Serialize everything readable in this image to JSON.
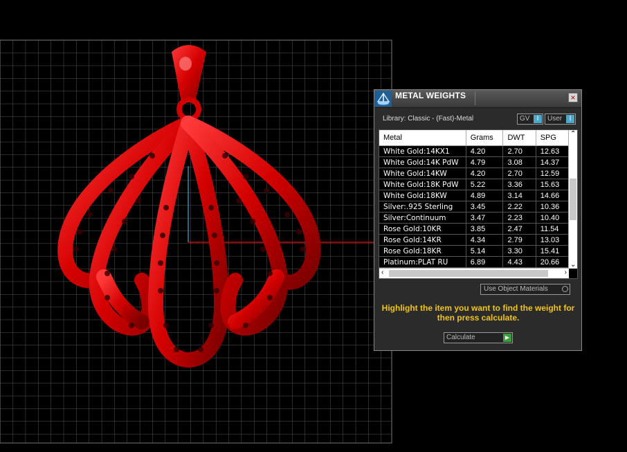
{
  "panel": {
    "title": "METAL WEIGHTS",
    "close_label": "×",
    "library_label": "Library: Classic - (Fast)-Metal",
    "toggles": {
      "gv": "GV",
      "user": "User",
      "knob": "I"
    },
    "columns": [
      "Metal",
      "Grams",
      "DWT",
      "SPG"
    ],
    "rows": [
      [
        "White Gold:14KX1",
        "4.20",
        "2.70",
        "12.63"
      ],
      [
        "White Gold:14K PdW",
        "4.79",
        "3.08",
        "14.37"
      ],
      [
        "White Gold:14KW",
        "4.20",
        "2.70",
        "12.59"
      ],
      [
        "White Gold:18K PdW",
        "5.22",
        "3.36",
        "15.63"
      ],
      [
        "White Gold:18KW",
        "4.89",
        "3.14",
        "14.66"
      ],
      [
        "Silver:.925 Sterling",
        "3.45",
        "2.22",
        "10.36"
      ],
      [
        "Silver:Continuum",
        "3.47",
        "2.23",
        "10.40"
      ],
      [
        "Rose Gold:10KR",
        "3.85",
        "2.47",
        "11.54"
      ],
      [
        "Rose Gold:14KR",
        "4.34",
        "2.79",
        "13.03"
      ],
      [
        "Rose Gold:18KR",
        "5.14",
        "3.30",
        "15.41"
      ],
      [
        "Platinum:PLAT RU",
        "6.89",
        "4.43",
        "20.66"
      ]
    ],
    "use_object_materials": "Use Object Materials",
    "hint": "Highlight the item you want to find the weight for then press calculate.",
    "calculate_label": "Calculate"
  },
  "colors": {
    "accent": "#4ea6c8",
    "hint": "#f0c419",
    "model": "#e00000"
  }
}
